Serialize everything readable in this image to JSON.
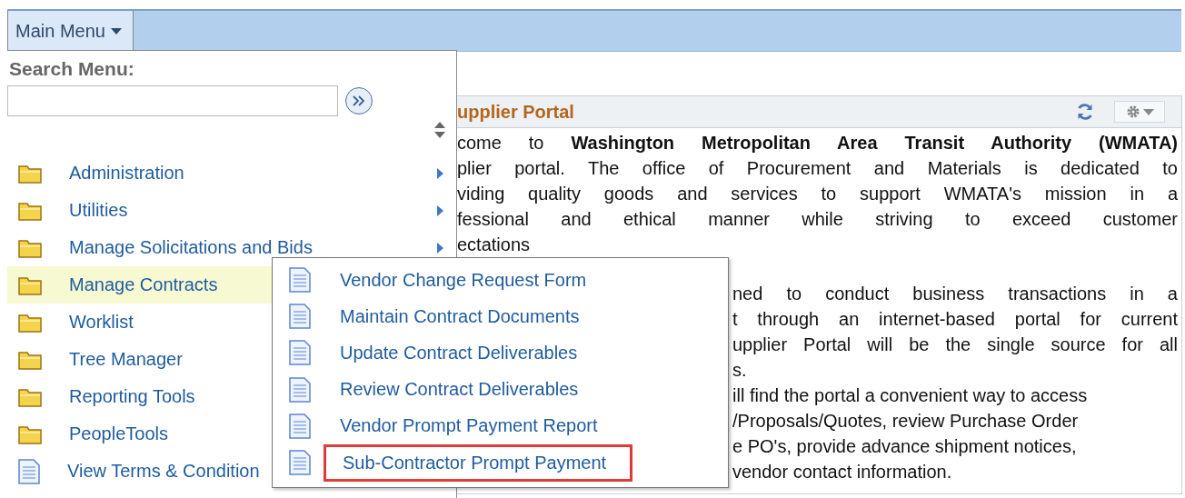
{
  "top_bar": {
    "menu_button": "Main Menu"
  },
  "pagelet": {
    "title": "upplier Portal",
    "paragraphs": [
      {
        "indented": false,
        "lines": [
          {
            "text": "come to **Washington Metropolitan Area Transit Authority (WMATA)**",
            "justified": true
          },
          {
            "text": "plier portal. The office of Procurement and Materials is dedicated to",
            "justified": true
          },
          {
            "text": "viding quality goods and services to support WMATA's mission in a",
            "justified": true
          },
          {
            "text": "fessional and ethical manner while striving to exceed customer",
            "justified": true
          },
          {
            "text": "ectations"
          }
        ]
      },
      {
        "indented": true,
        "lines": [
          {
            "text": "ned to conduct business transactions in a",
            "justified": true
          },
          {
            "text": "t through an internet-based portal for current",
            "justified": true
          },
          {
            "text": "upplier Portal will be the single source for all",
            "justified": true
          },
          {
            "text": "s."
          },
          {
            "text": "ill find the portal a convenient way to access",
            "justified": false
          },
          {
            "text": "/Proposals/Quotes, review Purchase Order",
            "justified": false
          },
          {
            "text": "e PO's, provide advance shipment notices,",
            "justified": false
          },
          {
            "text": "vendor contact information.",
            "justified": false
          }
        ]
      }
    ]
  },
  "menu": {
    "search_label": "Search Menu:",
    "items": [
      {
        "kind": "folder",
        "label": "Administration",
        "arrow": true,
        "selected": false
      },
      {
        "kind": "folder",
        "label": "Utilities",
        "arrow": true,
        "selected": false
      },
      {
        "kind": "folder",
        "label": "Manage Solicitations and Bids",
        "arrow": true,
        "selected": false
      },
      {
        "kind": "folder",
        "label": "Manage Contracts",
        "selected": true
      },
      {
        "kind": "folder",
        "label": "Worklist",
        "selected": false
      },
      {
        "kind": "folder",
        "label": "Tree Manager",
        "selected": false
      },
      {
        "kind": "folder",
        "label": "Reporting Tools",
        "selected": false
      },
      {
        "kind": "folder",
        "label": "PeopleTools",
        "selected": false
      },
      {
        "kind": "page",
        "label": "View Terms & Condition",
        "selected": false
      }
    ]
  },
  "submenu": {
    "items": [
      {
        "label": "Vendor Change Request Form",
        "highlighted": false
      },
      {
        "label": "Maintain Contract Documents",
        "highlighted": false
      },
      {
        "label": "Update Contract Deliverables",
        "highlighted": false
      },
      {
        "label": "Review Contract Deliverables",
        "highlighted": false
      },
      {
        "label": "Vendor Prompt Payment Report",
        "highlighted": false
      },
      {
        "label": "Sub-Contractor Prompt Payment",
        "highlighted": true
      }
    ]
  }
}
